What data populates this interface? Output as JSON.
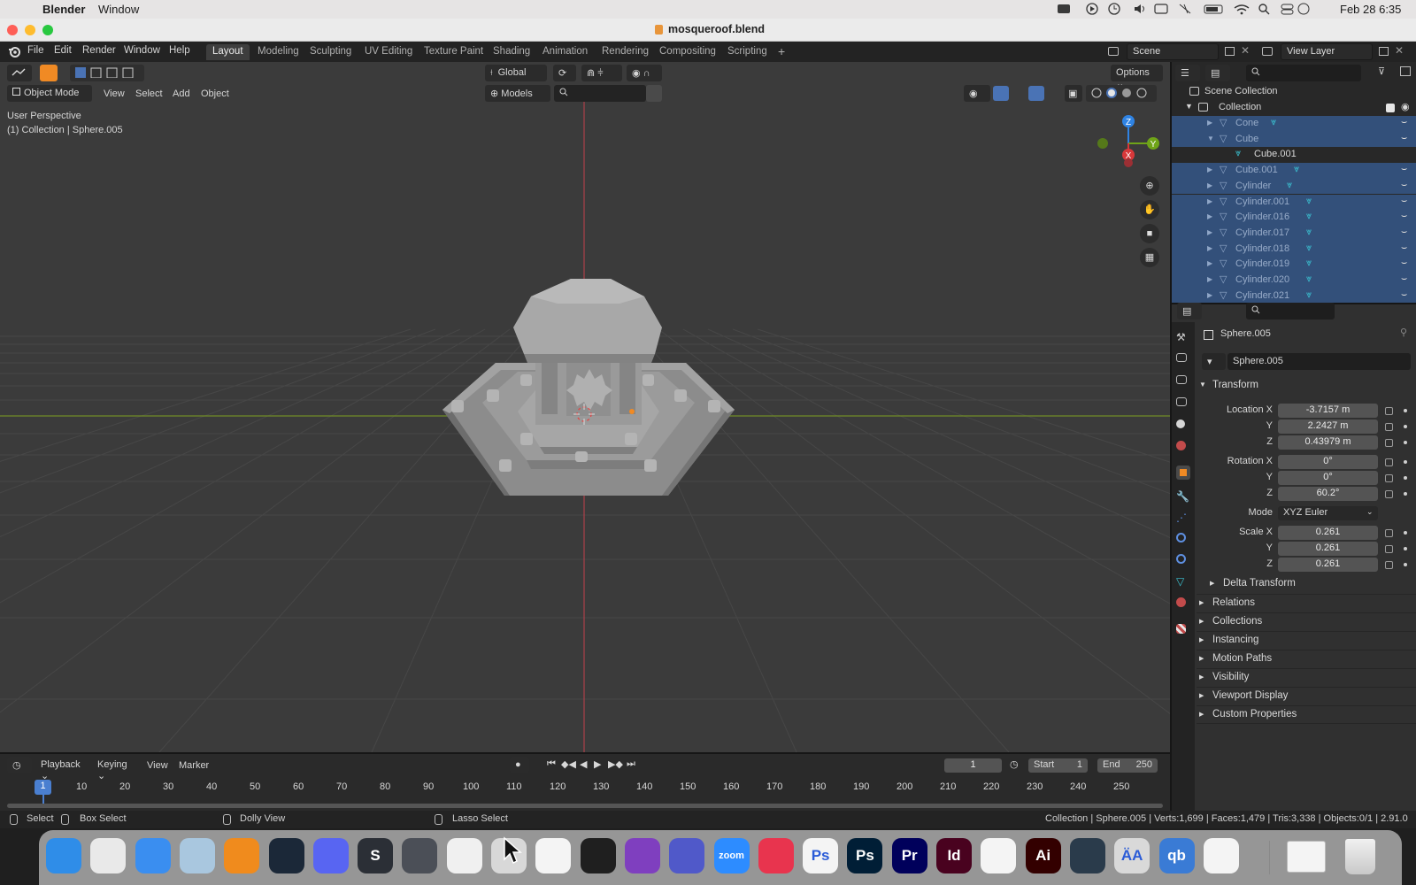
{
  "mac_menubar": {
    "app_name": "Blender",
    "menu_window": "Window",
    "clock": "Feb 28  6:35"
  },
  "window": {
    "title": "mosqueroof.blend"
  },
  "topbar": {
    "menus": [
      "File",
      "Edit",
      "Render",
      "Window",
      "Help"
    ],
    "workspaces": [
      "Layout",
      "Modeling",
      "Sculpting",
      "UV Editing",
      "Texture Paint",
      "Shading",
      "Animation",
      "Rendering",
      "Compositing",
      "Scripting"
    ],
    "active_workspace": "Layout",
    "add_workspace": "+",
    "scene": "Scene",
    "view_layer": "View Layer"
  },
  "viewport": {
    "mode": "Object Mode",
    "menus": [
      "View",
      "Select",
      "Add",
      "Object"
    ],
    "orientation": "Global",
    "collection_filter": "Models",
    "options": "Options",
    "overlay_view": "User Perspective",
    "overlay_info": "(1) Collection | Sphere.005",
    "gizmo_axes": {
      "x": "X",
      "y": "Y",
      "z": "Z"
    }
  },
  "outliner": {
    "root": "Scene Collection",
    "collection": "Collection",
    "items": [
      {
        "label": "Cone",
        "indent": 1,
        "expanded": false
      },
      {
        "label": "Cube",
        "indent": 1,
        "expanded": true
      },
      {
        "label": "Cube.001",
        "indent": 2,
        "child": true
      },
      {
        "label": "Cube.001",
        "indent": 1,
        "expanded": false
      },
      {
        "label": "Cylinder",
        "indent": 1,
        "expanded": false
      },
      {
        "label": "Cylinder.001",
        "indent": 1,
        "expanded": false
      },
      {
        "label": "Cylinder.016",
        "indent": 1,
        "expanded": false
      },
      {
        "label": "Cylinder.017",
        "indent": 1,
        "expanded": false
      },
      {
        "label": "Cylinder.018",
        "indent": 1,
        "expanded": false
      },
      {
        "label": "Cylinder.019",
        "indent": 1,
        "expanded": false
      },
      {
        "label": "Cylinder.020",
        "indent": 1,
        "expanded": false
      },
      {
        "label": "Cylinder.021",
        "indent": 1,
        "expanded": false
      }
    ]
  },
  "properties": {
    "object_name": "Sphere.005",
    "object_field": "Sphere.005",
    "transform_title": "Transform",
    "location": {
      "label_x": "Location X",
      "label_y": "Y",
      "label_z": "Z",
      "x": "-3.7157 m",
      "y": "2.2427 m",
      "z": "0.43979 m"
    },
    "rotation": {
      "label_x": "Rotation X",
      "label_y": "Y",
      "label_z": "Z",
      "x": "0°",
      "y": "0°",
      "z": "60.2°"
    },
    "mode": {
      "label": "Mode",
      "value": "XYZ Euler"
    },
    "scale": {
      "label_x": "Scale X",
      "label_y": "Y",
      "label_z": "Z",
      "x": "0.261",
      "y": "0.261",
      "z": "0.261"
    },
    "delta_transform": "Delta Transform",
    "sections": [
      "Relations",
      "Collections",
      "Instancing",
      "Motion Paths",
      "Visibility",
      "Viewport Display",
      "Custom Properties"
    ]
  },
  "timeline": {
    "menus": [
      "Playback",
      "Keying",
      "View",
      "Marker"
    ],
    "current_frame": "1",
    "start_label": "Start",
    "start": "1",
    "end_label": "End",
    "end": "250",
    "ticks": [
      "1",
      "10",
      "20",
      "30",
      "40",
      "50",
      "60",
      "70",
      "80",
      "90",
      "100",
      "110",
      "120",
      "130",
      "140",
      "150",
      "160",
      "170",
      "180",
      "190",
      "200",
      "210",
      "220",
      "230",
      "240",
      "250"
    ],
    "playhead": "1"
  },
  "statusbar": {
    "select": "Select",
    "box_select": "Box Select",
    "dolly_view": "Dolly View",
    "lasso_select": "Lasso Select",
    "stats": "Collection | Sphere.005 | Verts:1,699 | Faces:1,479 | Tris:3,338 | Objects:0/1 | 2.91.0"
  },
  "dock": {
    "apps": [
      {
        "name": "finder-app",
        "color": "#2f8de8",
        "glyph": ""
      },
      {
        "name": "launchpad-app",
        "color": "#e9e9e9",
        "glyph": ""
      },
      {
        "name": "mail-app",
        "color": "#3a8ef0",
        "glyph": ""
      },
      {
        "name": "preview-app",
        "color": "#a9c7df",
        "glyph": ""
      },
      {
        "name": "vlc-app",
        "color": "#f08b1d",
        "glyph": ""
      },
      {
        "name": "steam-app",
        "color": "#1b2838",
        "glyph": ""
      },
      {
        "name": "discord-app",
        "color": "#5865f2",
        "glyph": ""
      },
      {
        "name": "sublime-app",
        "color": "#2b2f36",
        "glyph": "S"
      },
      {
        "name": "unity-app",
        "color": "#4b4f57",
        "glyph": ""
      },
      {
        "name": "blender-app",
        "color": "#f0f0f0",
        "glyph": ""
      },
      {
        "name": "cursor-app",
        "color": "#d8d8d8",
        "glyph": ""
      },
      {
        "name": "vscode-app",
        "color": "#f4f4f4",
        "glyph": ""
      },
      {
        "name": "unity-hub-app",
        "color": "#1f1f1f",
        "glyph": ""
      },
      {
        "name": "github-app",
        "color": "#7f3fbf",
        "glyph": ""
      },
      {
        "name": "teams-app",
        "color": "#5059c9",
        "glyph": ""
      },
      {
        "name": "zoom-app",
        "color": "#2d8cff",
        "glyph": "zoom"
      },
      {
        "name": "creative-cloud-app",
        "color": "#e8344e",
        "glyph": ""
      },
      {
        "name": "photoshop-express-app",
        "color": "#f4f4f4",
        "glyph": "Ps"
      },
      {
        "name": "photoshop-app",
        "color": "#001e36",
        "glyph": "Ps"
      },
      {
        "name": "premiere-app",
        "color": "#00005b",
        "glyph": "Pr"
      },
      {
        "name": "indesign-app",
        "color": "#49021f",
        "glyph": "Id"
      },
      {
        "name": "acrobat-app",
        "color": "#f4f4f4",
        "glyph": ""
      },
      {
        "name": "illustrator-app",
        "color": "#330000",
        "glyph": "Ai"
      },
      {
        "name": "quicktime-app",
        "color": "#2a3b4b",
        "glyph": ""
      },
      {
        "name": "font-book-app",
        "color": "#d9d9d9",
        "glyph": "ÄA"
      },
      {
        "name": "qbittorrent-app",
        "color": "#3a7bd5",
        "glyph": "qb"
      },
      {
        "name": "chrome-app",
        "color": "#f4f4f4",
        "glyph": ""
      }
    ]
  },
  "colors": {
    "viewport_bg": "#3b3b3b",
    "selection": "#33507a",
    "axis_x": "#d8383a",
    "axis_y": "#6fa418",
    "axis_z": "#2f83e3",
    "active_orange": "#f08a24"
  }
}
